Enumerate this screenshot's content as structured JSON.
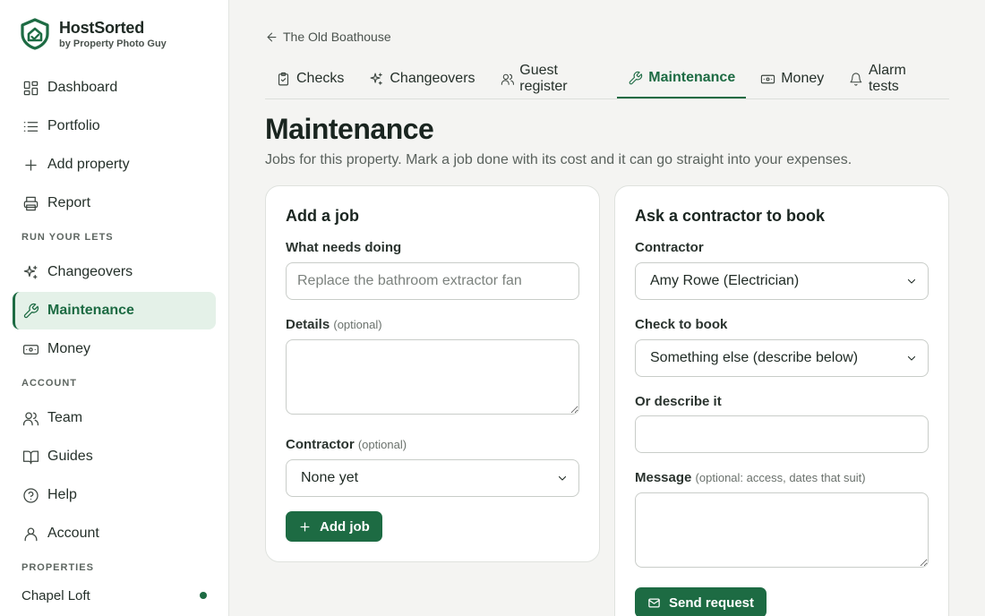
{
  "brand": {
    "name": "HostSorted",
    "sub": "by Property Photo Guy",
    "accent": "#1d6b43"
  },
  "sidebar": {
    "items_top": [
      {
        "label": "Dashboard",
        "icon": "dashboard-icon"
      },
      {
        "label": "Portfolio",
        "icon": "list-icon"
      },
      {
        "label": "Add property",
        "icon": "plus-icon"
      },
      {
        "label": "Report",
        "icon": "printer-icon"
      }
    ],
    "section_run": "RUN YOUR LETS",
    "items_run": [
      {
        "label": "Changeovers",
        "icon": "sparkles-icon"
      },
      {
        "label": "Maintenance",
        "icon": "wrench-icon",
        "active": true
      },
      {
        "label": "Money",
        "icon": "banknote-icon"
      }
    ],
    "section_account": "ACCOUNT",
    "items_account": [
      {
        "label": "Team",
        "icon": "users-icon"
      },
      {
        "label": "Guides",
        "icon": "book-icon"
      },
      {
        "label": "Help",
        "icon": "help-icon"
      },
      {
        "label": "Account",
        "icon": "user-icon"
      }
    ],
    "section_properties": "PROPERTIES",
    "properties": [
      {
        "label": "Chapel Loft"
      }
    ]
  },
  "main": {
    "back_label": "The Old Boathouse",
    "tabs": [
      {
        "label": "Checks",
        "icon": "clipboard-check-icon"
      },
      {
        "label": "Changeovers",
        "icon": "sparkles-icon"
      },
      {
        "label": "Guest register",
        "icon": "users-icon"
      },
      {
        "label": "Maintenance",
        "icon": "wrench-icon",
        "active": true
      },
      {
        "label": "Money",
        "icon": "banknote-icon"
      },
      {
        "label": "Alarm tests",
        "icon": "bell-icon"
      }
    ],
    "title": "Maintenance",
    "subtitle": "Jobs for this property. Mark a job done with its cost and it can go straight into your expenses."
  },
  "add_job": {
    "title": "Add a job",
    "what_label": "What needs doing",
    "what_placeholder": "Replace the bathroom extractor fan",
    "details_label": "Details",
    "details_optional": "(optional)",
    "contractor_label": "Contractor",
    "contractor_optional": "(optional)",
    "contractor_value": "None yet",
    "button": "Add job"
  },
  "ask_contractor": {
    "title": "Ask a contractor to book",
    "contractor_label": "Contractor",
    "contractor_value": "Amy Rowe (Electrician)",
    "check_label": "Check to book",
    "check_value": "Something else (describe below)",
    "describe_label": "Or describe it",
    "message_label": "Message",
    "message_optional": "(optional: access, dates that suit)",
    "button": "Send request"
  }
}
